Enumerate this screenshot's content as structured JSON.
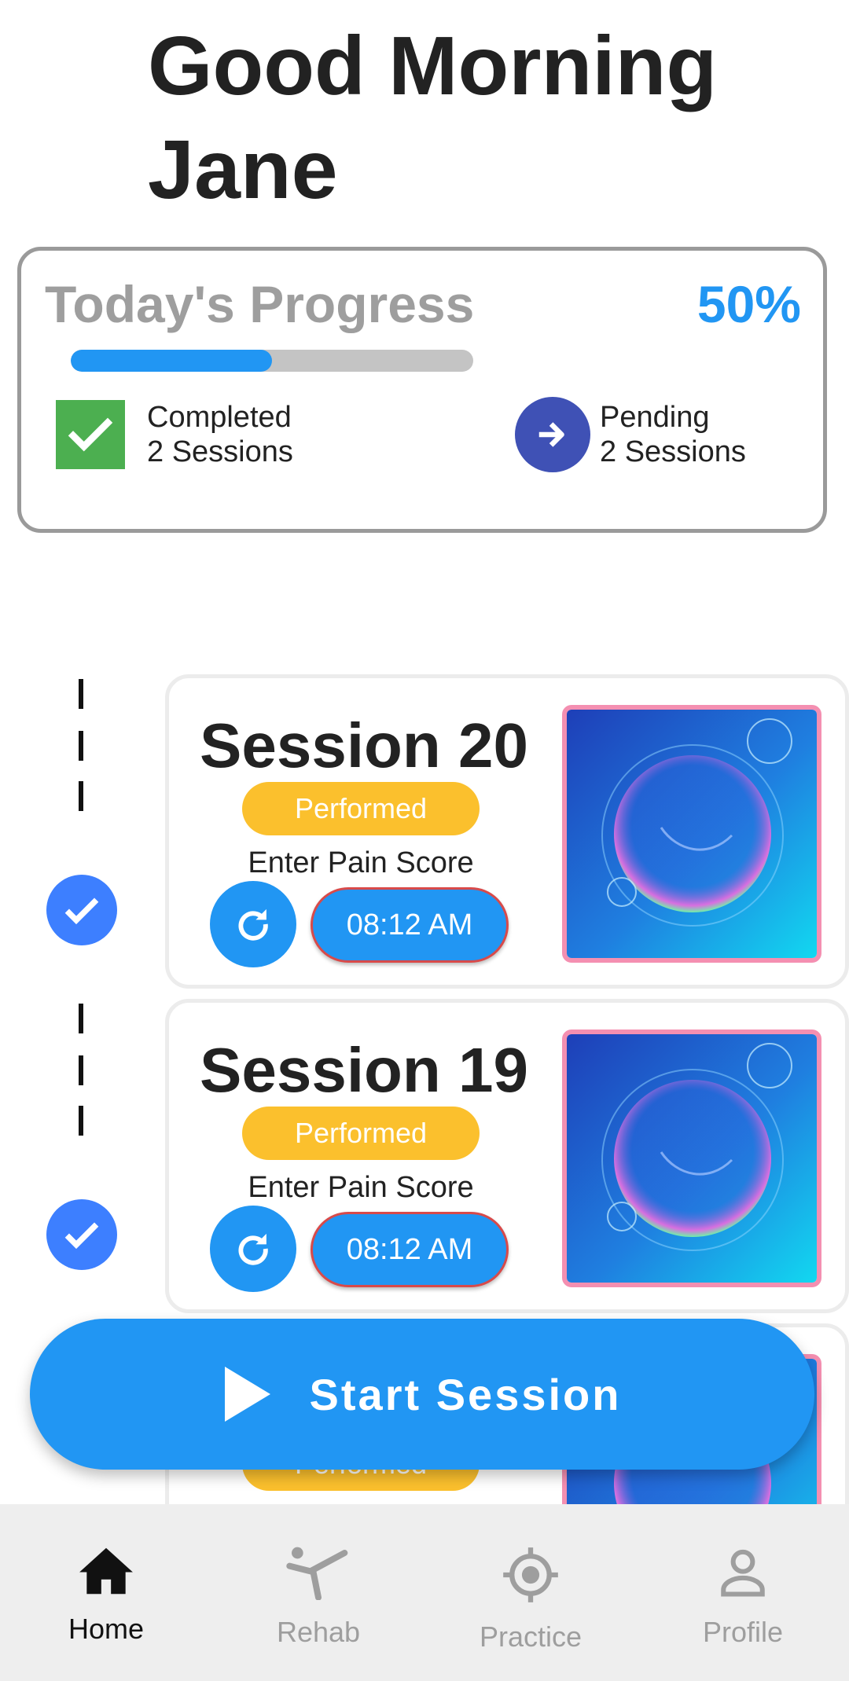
{
  "greeting": {
    "line1": "Good Morning",
    "line2": "Jane"
  },
  "progress": {
    "title": "Today's Progress",
    "percent_label": "50%",
    "fraction": 0.5,
    "completed": {
      "label": "Completed",
      "count": "2 Sessions",
      "icon": "check-square-icon"
    },
    "pending": {
      "label": "Pending",
      "count": "2 Sessions",
      "icon": "arrow-right-circle-icon"
    }
  },
  "sessions": [
    {
      "title": "Session 20",
      "status": "Performed",
      "pain_label": "Enter Pain Score",
      "time": "08:12 AM"
    },
    {
      "title": "Session 19",
      "status": "Performed",
      "pain_label": "Enter Pain Score",
      "time": "08:12 AM"
    }
  ],
  "start_button": {
    "label": "Start Session",
    "icon": "play-icon"
  },
  "nav": {
    "items": [
      {
        "label": "Home",
        "icon": "home-icon",
        "active": true
      },
      {
        "label": "Rehab",
        "icon": "exercise-icon",
        "active": false
      },
      {
        "label": "Practice",
        "icon": "target-icon",
        "active": false
      },
      {
        "label": "Profile",
        "icon": "person-icon",
        "active": false
      }
    ]
  },
  "colors": {
    "accent": "#2196f3",
    "performed": "#fbc02d",
    "completed_green": "#4caf50",
    "pending_indigo": "#3f51b5",
    "timeline_check": "#3d7fff"
  }
}
